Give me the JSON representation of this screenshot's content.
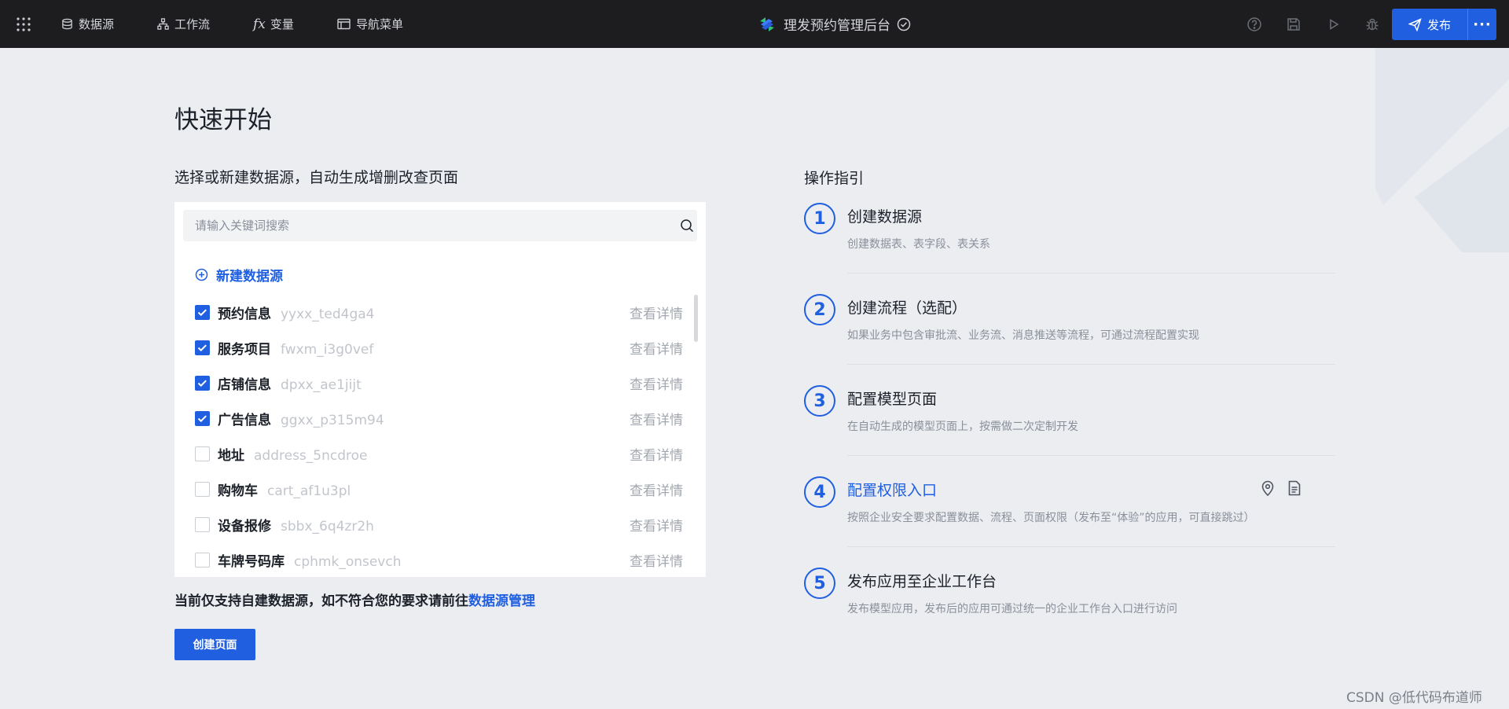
{
  "topbar": {
    "nav": [
      "数据源",
      "工作流",
      "变量",
      "导航菜单"
    ],
    "app_title": "理发预约管理后台",
    "publish_label": "发布",
    "more_label": "···"
  },
  "main": {
    "title": "快速开始",
    "left_subtitle": "选择或新建数据源，自动生成增删改查页面",
    "search_placeholder": "请输入关键词搜索",
    "new_datasource_label": "新建数据源",
    "datasources": [
      {
        "name": "预约信息",
        "code": "yyxx_ted4ga4",
        "checked": true,
        "detail": "查看详情"
      },
      {
        "name": "服务项目",
        "code": "fwxm_i3g0vef",
        "checked": true,
        "detail": "查看详情"
      },
      {
        "name": "店铺信息",
        "code": "dpxx_ae1jijt",
        "checked": true,
        "detail": "查看详情"
      },
      {
        "name": "广告信息",
        "code": "ggxx_p315m94",
        "checked": true,
        "detail": "查看详情"
      },
      {
        "name": "地址",
        "code": "address_5ncdroe",
        "checked": false,
        "detail": "查看详情"
      },
      {
        "name": "购物车",
        "code": "cart_af1u3pl",
        "checked": false,
        "detail": "查看详情"
      },
      {
        "name": "设备报修",
        "code": "sbbx_6q4zr2h",
        "checked": false,
        "detail": "查看详情"
      },
      {
        "name": "车牌号码库",
        "code": "cphmk_onsevch",
        "checked": false,
        "detail": "查看详情"
      }
    ],
    "notice_text": "当前仅支持自建数据源，如不符合您的要求请前往",
    "notice_link": "数据源管理",
    "create_button": "创建页面"
  },
  "guide": {
    "title": "操作指引",
    "steps": [
      {
        "num": "1",
        "title": "创建数据源",
        "desc": "创建数据表、表字段、表关系"
      },
      {
        "num": "2",
        "title": "创建流程（选配）",
        "desc": "如果业务中包含审批流、业务流、消息推送等流程，可通过流程配置实现"
      },
      {
        "num": "3",
        "title": "配置模型页面",
        "desc": "在自动生成的模型页面上，按需做二次定制开发"
      },
      {
        "num": "4",
        "title": "配置权限入口",
        "desc": "按照企业安全要求配置数据、流程、页面权限（发布至“体验”的应用，可直接跳过）"
      },
      {
        "num": "5",
        "title": "发布应用至企业工作台",
        "desc": "发布模型应用，发布后的应用可通过统一的企业工作台入口进行访问"
      }
    ]
  },
  "watermark": "CSDN @低代码布道师",
  "colors": {
    "accent": "#1f5fe0",
    "topbar": "#1d1d1f",
    "background": "#ebedf1"
  }
}
